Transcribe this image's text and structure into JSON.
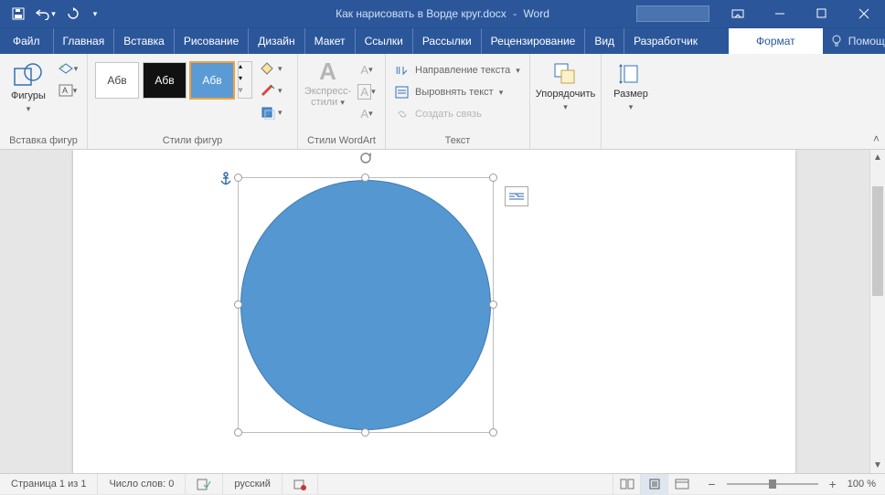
{
  "titlebar": {
    "doc_title": "Как нарисовать в Ворде круг.docx",
    "dash": "-",
    "app": "Word"
  },
  "tabs": {
    "file": "Файл",
    "home": "Главная",
    "insert": "Вставка",
    "draw": "Рисование",
    "design": "Дизайн",
    "layout": "Макет",
    "references": "Ссылки",
    "mailings": "Рассылки",
    "review": "Рецензирование",
    "view": "Вид",
    "developer": "Разработчик",
    "format": "Формат",
    "help": "Помощн"
  },
  "ribbon": {
    "insert_shapes": {
      "shapes": "Фигуры",
      "label": "Вставка фигур"
    },
    "shape_styles": {
      "sample": "Абв",
      "label": "Стили фигур"
    },
    "wordart": {
      "express1": "Экспресс-",
      "express2": "стили",
      "label": "Стили WordArt"
    },
    "text": {
      "direction": "Направление текста",
      "align": "Выровнять текст",
      "link": "Создать связь",
      "label": "Текст"
    },
    "arrange": {
      "btn": "Упорядочить"
    },
    "size": {
      "btn": "Размер"
    }
  },
  "status": {
    "page": "Страница 1 из 1",
    "words": "Число слов: 0",
    "lang": "русский",
    "zoom": "100 %"
  }
}
